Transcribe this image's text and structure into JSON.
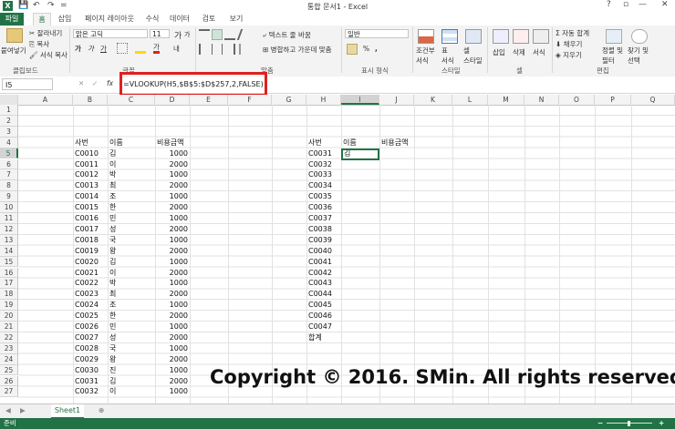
{
  "window": {
    "title": "통합 문서1 - Excel",
    "help": "?",
    "restore": "▫",
    "minimize": "—",
    "close": "✕"
  },
  "qat": {
    "save": "💾",
    "undo": "↶",
    "redo": "↷",
    "more": "="
  },
  "tabs": [
    "파일",
    "홈",
    "삽입",
    "페이지 레이아웃",
    "수식",
    "데이터",
    "검토",
    "보기"
  ],
  "ribbon": {
    "paste": "붙여넣기",
    "cut": "잘라내기",
    "copy": "복사",
    "format_painter": "서식 복사",
    "font_name": "맑은 고딕",
    "font_size": "11",
    "grow": "가",
    "shrink": "가",
    "bold": "가",
    "italic": "가",
    "underline": "가",
    "font_color": "가",
    "phonetic": "내",
    "wrap_text": "텍스트 줄 바꿈",
    "merge_center": "병합하고 가운데 맞춤",
    "number_format": "일반",
    "percent": "%",
    "comma": ",",
    "conditional": "조건부\n서식",
    "format_table": "표\n서식",
    "cell_styles": "셀\n스타일",
    "insert": "삽입",
    "delete": "삭제",
    "format": "서식",
    "autosum": "자동 합계",
    "fill": "채우기",
    "clear": "지우기",
    "sort_filter": "정렬 및\n필터",
    "find_select": "찾기 및\n선택",
    "groups": {
      "clipboard": "클립보드",
      "font": "글꼴",
      "alignment": "맞춤",
      "number": "표시 형식",
      "styles": "스타일",
      "cells": "셀",
      "editing": "편집"
    }
  },
  "formula_bar": {
    "name_box": "I5",
    "cancel": "✕",
    "enter": "✓",
    "fx": "fx",
    "formula": "=VLOOKUP(H5,$B$5:$D$257,2,FALSE)"
  },
  "columns": [
    "A",
    "B",
    "C",
    "D",
    "E",
    "F",
    "G",
    "H",
    "I",
    "J",
    "K",
    "L",
    "M",
    "N",
    "O",
    "P",
    "Q"
  ],
  "rows": [
    "1",
    "2",
    "3",
    "4",
    "5",
    "6",
    "7",
    "8",
    "9",
    "10",
    "11",
    "12",
    "13",
    "14",
    "15",
    "16",
    "17",
    "18",
    "19",
    "20",
    "21",
    "22",
    "23",
    "24",
    "25",
    "26",
    "27"
  ],
  "table_left": {
    "headers": [
      "사번",
      "이름",
      "비용금액"
    ],
    "rows": [
      [
        "C0010",
        "김",
        "1000"
      ],
      [
        "C0011",
        "이",
        "2000"
      ],
      [
        "C0012",
        "박",
        "1000"
      ],
      [
        "C0013",
        "최",
        "2000"
      ],
      [
        "C0014",
        "조",
        "1000"
      ],
      [
        "C0015",
        "한",
        "2000"
      ],
      [
        "C0016",
        "민",
        "1000"
      ],
      [
        "C0017",
        "성",
        "2000"
      ],
      [
        "C0018",
        "국",
        "1000"
      ],
      [
        "C0019",
        "왕",
        "2000"
      ],
      [
        "C0020",
        "김",
        "1000"
      ],
      [
        "C0021",
        "이",
        "2000"
      ],
      [
        "C0022",
        "박",
        "1000"
      ],
      [
        "C0023",
        "최",
        "2000"
      ],
      [
        "C0024",
        "조",
        "1000"
      ],
      [
        "C0025",
        "한",
        "2000"
      ],
      [
        "C0026",
        "민",
        "1000"
      ],
      [
        "C0027",
        "성",
        "2000"
      ],
      [
        "C0028",
        "국",
        "1000"
      ],
      [
        "C0029",
        "왕",
        "2000"
      ],
      [
        "C0030",
        "진",
        "1000"
      ],
      [
        "C0031",
        "김",
        "2000"
      ],
      [
        "C0032",
        "이",
        "1000"
      ]
    ]
  },
  "table_right": {
    "headers": [
      "사번",
      "이름",
      "비용금액"
    ],
    "ids": [
      "C0031",
      "C0032",
      "C0033",
      "C0034",
      "C0035",
      "C0036",
      "C0037",
      "C0038",
      "C0039",
      "C0040",
      "C0041",
      "C0042",
      "C0043",
      "C0044",
      "C0045",
      "C0046",
      "C0047"
    ],
    "total": "합계",
    "i5_value": "김"
  },
  "sheets": {
    "prev": "◀",
    "next": "▶",
    "sheet1": "Sheet1",
    "add": "⊕"
  },
  "status": {
    "ready": "준비",
    "zoom_minus": "−",
    "zoom_plus": "+"
  },
  "copyright": "Copyright © 2016. SMin. All rights reserved."
}
